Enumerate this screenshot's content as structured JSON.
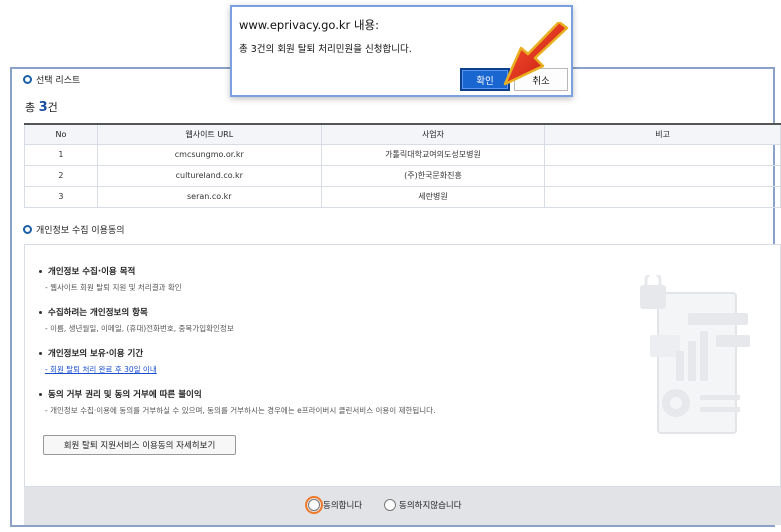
{
  "dialog": {
    "host": "www.eprivacy.go.kr 내용:",
    "message": "총 3건의 회원 탈퇴 처리민원을 신청합니다.",
    "ok_label": "확인",
    "cancel_label": "취소"
  },
  "list": {
    "section_title": "선택 리스트",
    "count_prefix": "총 ",
    "count_value": "3",
    "count_suffix": "건",
    "headers": [
      "No",
      "웹사이트 URL",
      "사업자",
      "비고"
    ],
    "rows": [
      [
        "1",
        "cmcsungmo.or.kr",
        "가톨릭대학교여의도성모병원",
        ""
      ],
      [
        "2",
        "cultureland.co.kr",
        "(주)한국문화진흥",
        ""
      ],
      [
        "3",
        "seran.co.kr",
        "세란병원",
        ""
      ]
    ]
  },
  "consent": {
    "section_title": "개인정보 수집 이용동의",
    "items": [
      {
        "title": "개인정보 수집·이용 목적",
        "desc": "- 웹사이트 회원 탈퇴 지원 및 처리결과 확인"
      },
      {
        "title": "수집하려는 개인정보의 항목",
        "desc": "- 이름, 생년월일, 이메일, (휴대)전화번호, 중복가입확인정보"
      },
      {
        "title": "개인정보의 보유·이용 기간",
        "desc": "- 회원 탈퇴 처리 완료 후 30일 이내"
      },
      {
        "title": "동의 거부 권리 및 동의 거부에 따른 불이익",
        "desc": "- 개인정보 수집·이용에 동의를 거부하실 수 있으며, 동의를 거부하시는 경우에는 e프라이버시 클린서비스 이용이 제한됩니다."
      }
    ],
    "detail_button": "회원 탈퇴 지원서비스 이용동의 자세히보기",
    "agree_label": "동의합니다",
    "disagree_label": "동의하지않습니다"
  },
  "icons": {
    "section_marker": "ring-icon",
    "arrow": "red-arrow-pointer",
    "illustration": "privacy-document-illustration"
  },
  "colors": {
    "accent": "#1a5fa8",
    "ok_button": "#1a66d0",
    "link": "#1a4fd0",
    "arrow": "#e02010",
    "focus": "#f07a2a"
  }
}
